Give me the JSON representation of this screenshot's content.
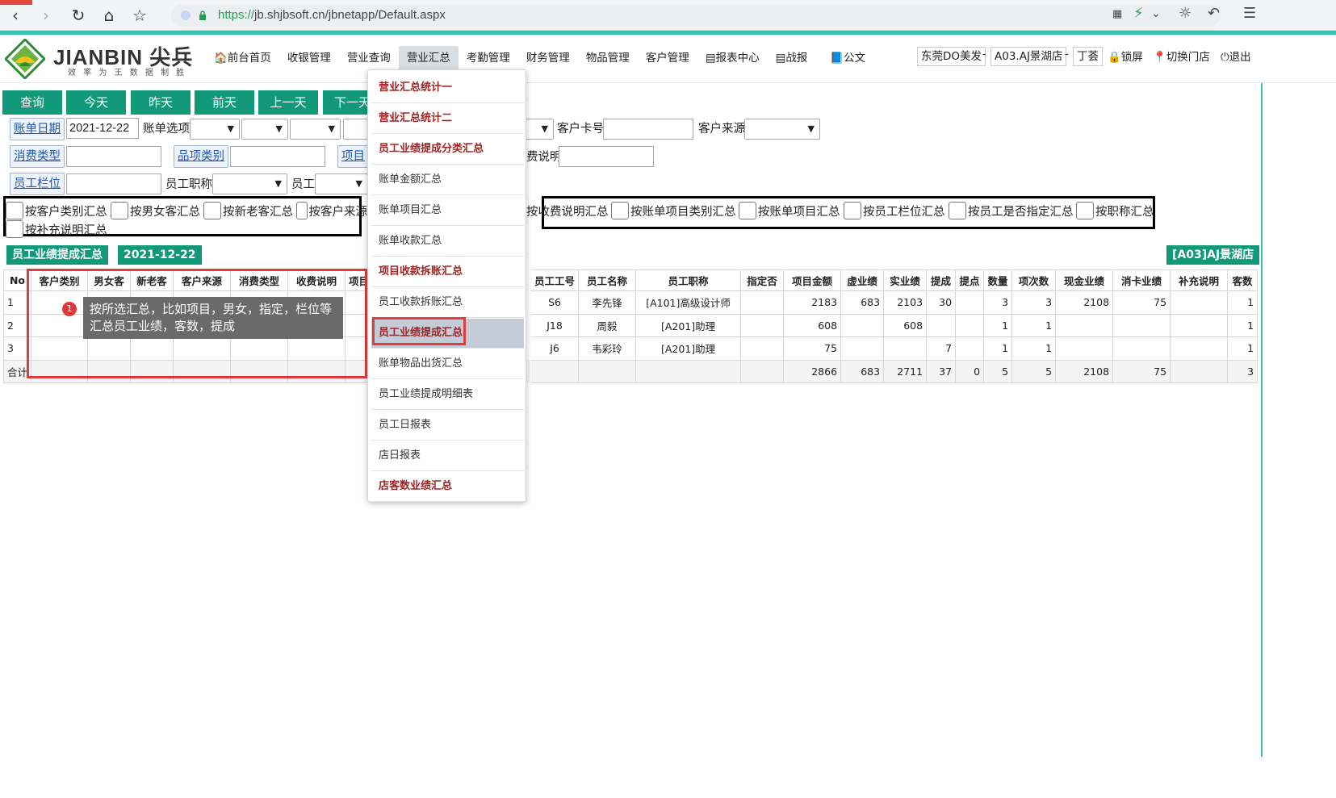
{
  "browser": {
    "url_scheme": "https://",
    "url_rest": "jb.shjbsoft.cn/jbnetapp/Default.aspx"
  },
  "header": {
    "logo_text": "JIANBIN 尖兵",
    "logo_sub": "效 率 为 王   数 据 制 胜",
    "menu": [
      {
        "label": "🏠前台首页"
      },
      {
        "label": "收银管理"
      },
      {
        "label": "营业查询"
      },
      {
        "label": "营业汇总"
      },
      {
        "label": "考勤管理"
      },
      {
        "label": "财务管理"
      },
      {
        "label": "物品管理"
      },
      {
        "label": "客户管理"
      },
      {
        "label": "▤报表中心"
      },
      {
        "label": "▤战报"
      },
      {
        "label": "📘公文"
      }
    ],
    "company": "东莞DO美发",
    "store": "A03.AJ景湖店",
    "user": "丁荟",
    "sep": "-",
    "lock": "🔒锁屏",
    "switch_store": "📍切换门店",
    "logout": "⏻退出"
  },
  "quick_buttons": [
    "查询",
    "今天",
    "昨天",
    "前天",
    "上一天",
    "下一天"
  ],
  "filters": {
    "bill_date_label": "账单日期",
    "bill_date_value": "2021-12-22",
    "bill_option_label": "账单选项",
    "customer_card_label": "客户卡号",
    "customer_source_label": "客户来源",
    "consume_type_label": "消费类型",
    "item_category_label": "品项类别",
    "item_label_partial": "项目",
    "fee_desc_partial": "费说明",
    "staff_slot_label": "员工栏位",
    "staff_title_label": "员工职称",
    "staff_label": "员工"
  },
  "checkboxes_left": [
    "按客户类别汇总",
    "按男女客汇总",
    "按新老客汇总",
    "按客户来源",
    "按补充说明汇总"
  ],
  "checkboxes_right": [
    "按收费说明汇总",
    "按账单项目类别汇总",
    "按账单项目汇总",
    "按员工栏位汇总",
    "按员工是否指定汇总",
    "按职称汇总"
  ],
  "report": {
    "title": "员工业绩提成汇总",
    "date": "2021-12-22",
    "store": "[A03]AJ景湖店"
  },
  "table": {
    "headers": [
      "No",
      "客户类别",
      "男女客",
      "新老客",
      "客户来源",
      "消费类型",
      "收费说明",
      "项目",
      "",
      "员工工号",
      "员工名称",
      "员工职称",
      "指定否",
      "项目金额",
      "虚业绩",
      "实业绩",
      "提成",
      "提点",
      "数量",
      "项次数",
      "现金业绩",
      "消卡业绩",
      "补充说明",
      "客数"
    ],
    "rows": [
      [
        "1",
        "",
        "",
        "",
        "",
        "",
        "",
        "",
        "",
        "S6",
        "李先锋",
        "[A101]高级设计师",
        "",
        "2183",
        "683",
        "2103",
        "30",
        "",
        "3",
        "3",
        "2108",
        "75",
        "",
        "1"
      ],
      [
        "2",
        "",
        "",
        "",
        "",
        "",
        "",
        "",
        "",
        "J18",
        "周毅",
        "[A201]助理",
        "",
        "608",
        "",
        "608",
        "",
        "",
        "1",
        "1",
        "",
        "",
        "",
        "1"
      ],
      [
        "3",
        "",
        "",
        "",
        "",
        "",
        "",
        "",
        "",
        "J6",
        "韦彩玲",
        "[A201]助理",
        "",
        "75",
        "",
        "",
        "7",
        "",
        "1",
        "1",
        "",
        "",
        "",
        "1"
      ]
    ],
    "total": [
      "合计",
      "",
      "",
      "",
      "",
      "",
      "",
      "",
      "",
      "",
      "",
      "",
      "",
      "2866",
      "683",
      "2711",
      "37",
      "0",
      "5",
      "5",
      "2108",
      "75",
      "",
      "3"
    ]
  },
  "tooltip": {
    "index": "1",
    "text": "按所选汇总，比如项目，男女，指定，栏位等汇总员工业绩，客数，提成"
  },
  "dropdown": {
    "items": [
      {
        "label": "营业汇总统计一",
        "bold": true
      },
      {
        "label": "营业汇总统计二",
        "bold": true
      },
      {
        "label": "员工业绩提成分类汇总",
        "bold": true
      },
      {
        "label": "账单金额汇总",
        "bold": false
      },
      {
        "label": "账单项目汇总",
        "bold": false
      },
      {
        "label": "账单收款汇总",
        "bold": false
      },
      {
        "label": "项目收款拆账汇总",
        "bold": true
      },
      {
        "label": "员工收款拆账汇总",
        "bold": false
      },
      {
        "label": "员工业绩提成汇总",
        "bold": true,
        "selected": true
      },
      {
        "label": "账单物品出货汇总",
        "bold": false
      },
      {
        "label": "员工业绩提成明细表",
        "bold": false
      },
      {
        "label": "员工日报表",
        "bold": false
      },
      {
        "label": "店日报表",
        "bold": false
      },
      {
        "label": "店客数业绩汇总",
        "bold": true
      }
    ]
  },
  "colors": {
    "accent_teal": "#12997a",
    "highlight_red": "#e03c3c",
    "menu_bold_red": "#a12525"
  }
}
